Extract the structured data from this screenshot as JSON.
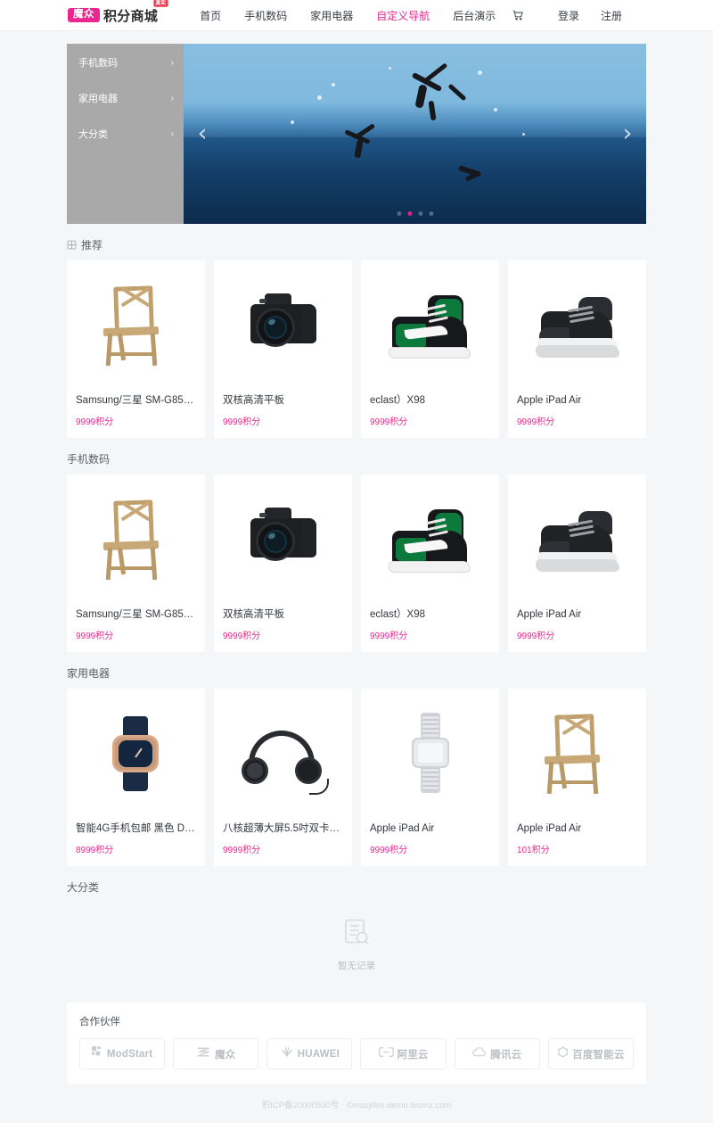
{
  "header": {
    "logo_badge": "魔众",
    "logo_name": "积分商城",
    "logo_sup": "真实",
    "nav": [
      {
        "label": "首页",
        "active": false
      },
      {
        "label": "手机数码",
        "active": false
      },
      {
        "label": "家用电器",
        "active": false
      },
      {
        "label": "自定义导航",
        "active": true
      },
      {
        "label": "后台演示",
        "active": false
      }
    ],
    "cart_icon": "cart-icon",
    "login_label": "登录",
    "register_label": "注册",
    "accent_color": "#ec268f"
  },
  "sidebar": {
    "items": [
      {
        "label": "手机数码",
        "chevron": "›"
      },
      {
        "label": "家用电器",
        "chevron": "›"
      },
      {
        "label": "大分类",
        "chevron": "›"
      }
    ]
  },
  "carousel": {
    "prev_arrow": "‹",
    "next_arrow": "›",
    "dots": 4,
    "active_dot": 1,
    "active_dot_color": "#e61f8d"
  },
  "sections": [
    {
      "title": "推荐",
      "icon": "grid-icon",
      "has_icon": true,
      "products": [
        {
          "title": "Samsung/三星 SM-G8508S ...",
          "price": "9999积分",
          "art": "chair"
        },
        {
          "title": "双核高清平板",
          "price": "9999积分",
          "art": "camera"
        },
        {
          "title": "eclast）X98",
          "price": "9999积分",
          "art": "sneaker"
        },
        {
          "title": "Apple iPad Air",
          "price": "9999积分",
          "art": "boot"
        }
      ]
    },
    {
      "title": "手机数码",
      "icon": "",
      "has_icon": false,
      "products": [
        {
          "title": "Samsung/三星 SM-G8508S ...",
          "price": "9999积分",
          "art": "chair"
        },
        {
          "title": "双核高清平板",
          "price": "9999积分",
          "art": "camera"
        },
        {
          "title": "eclast）X98",
          "price": "9999积分",
          "art": "sneaker"
        },
        {
          "title": "Apple iPad Air",
          "price": "9999积分",
          "art": "boot"
        }
      ]
    },
    {
      "title": "家用电器",
      "icon": "",
      "has_icon": false,
      "products": [
        {
          "title": "智能4G手机包邮 黑色 D-LT...",
          "price": "8999积分",
          "art": "watch"
        },
        {
          "title": "八核超薄大屏5.5吋双卡手机...",
          "price": "9999积分",
          "art": "headphones"
        },
        {
          "title": "Apple iPad Air",
          "price": "9999积分",
          "art": "bandwatch"
        },
        {
          "title": "Apple iPad Air",
          "price": "101积分",
          "art": "chair"
        }
      ]
    }
  ],
  "empty_section": {
    "title": "大分类",
    "icon": "empty-document-search-icon",
    "text": "暂无记录"
  },
  "partners": {
    "title": "合作伙伴",
    "items": [
      {
        "name": "ModStart",
        "icon": "modstart-squares-icon"
      },
      {
        "name": "魔众",
        "icon": "mozhong-icon"
      },
      {
        "name": "HUAWEI",
        "icon": "huawei-petal-icon"
      },
      {
        "name": "阿里云",
        "icon": "aliyun-bracket-icon"
      },
      {
        "name": "腾讯云",
        "icon": "tencent-cloud-icon"
      },
      {
        "name": "百度智能云",
        "icon": "baidu-cloud-icon"
      }
    ]
  },
  "footer": {
    "icp": "积ICP备20000530号",
    "copyright": "©mozjifen.demo.tecmz.com"
  }
}
